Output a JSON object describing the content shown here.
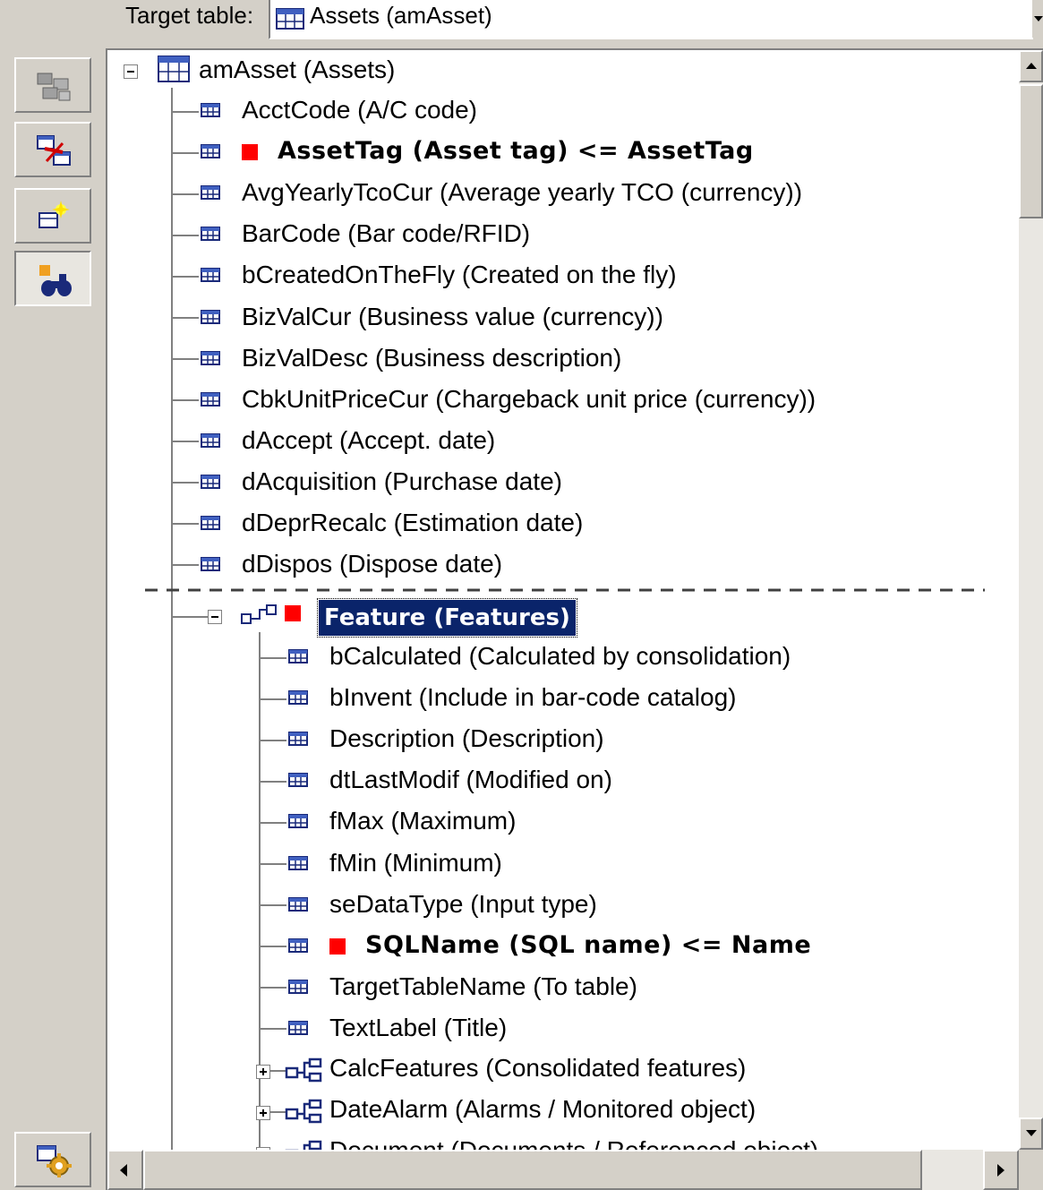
{
  "target": {
    "label": "Target table:",
    "value": "Assets (amAsset)"
  },
  "toolbar": {
    "buttons": [
      {
        "name": "table-view-icon"
      },
      {
        "name": "remove-link-icon"
      },
      {
        "name": "new-field-icon"
      },
      {
        "name": "find-binoculars-icon"
      },
      {
        "name": "settings-gear-icon"
      }
    ]
  },
  "tree": {
    "root": "amAsset (Assets)",
    "fields": [
      "AcctCode (A/C code)",
      "AssetTag (Asset tag)  <=  AssetTag",
      "AvgYearlyTcoCur (Average yearly TCO (currency))",
      "BarCode (Bar code/RFID)",
      "bCreatedOnTheFly (Created on the fly)",
      "BizValCur (Business value (currency))",
      "BizValDesc (Business description)",
      "CbkUnitPriceCur (Chargeback unit price (currency))",
      "dAccept (Accept. date)",
      "dAcquisition (Purchase date)",
      "dDeprRecalc (Estimation date)",
      "dDispos (Dispose date)"
    ],
    "link": "Feature (Features)",
    "link_fields": [
      "bCalculated (Calculated by consolidation)",
      "bInvent (Include in bar-code catalog)",
      "Description (Description)",
      "dtLastModif (Modified on)",
      "fMax (Maximum)",
      "fMin (Minimum)",
      "seDataType (Input type)",
      "SQLName (SQL name)  <=  Name",
      "TargetTableName (To table)",
      "TextLabel (Title)"
    ],
    "sub_links": [
      "CalcFeatures (Consolidated features)",
      "DateAlarm (Alarms / Monitored object)",
      "Document (Documents / Referenced object)"
    ]
  },
  "colors": {
    "mapped_marker": "#ff0000",
    "selection": "#0a246a"
  }
}
